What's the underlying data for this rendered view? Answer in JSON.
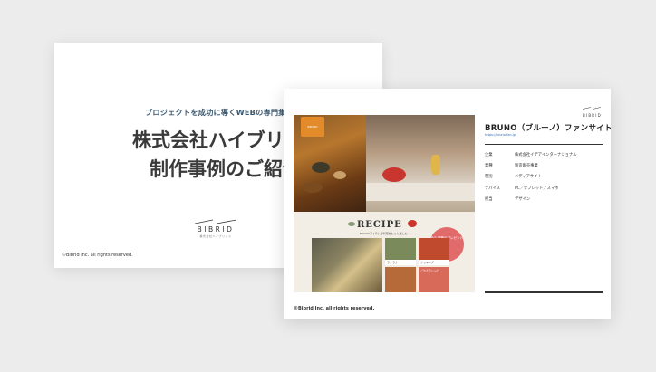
{
  "back_slide": {
    "tagline": "プロジェクトを成功に導くWEBの専門集団",
    "title_line1": "株式会社ハイブリッド",
    "title_line2": "制作事例のご紹介",
    "logo_word": "BIBRID",
    "logo_sub": "株式会社ハイブリッド",
    "copyright": "©Bibrid Inc. all rights reserved."
  },
  "front_slide": {
    "logo_word": "BIBRID",
    "case_title": "BRUNO（ブルーノ）ファンサイト",
    "case_url": "https://bruno-fan.jp",
    "info": [
      {
        "key": "企業",
        "value": "株式会社イデアインターナショナル"
      },
      {
        "key": "業種",
        "value": "製造販売事業"
      },
      {
        "key": "種別",
        "value": "メディアサイト"
      },
      {
        "key": "デバイス",
        "value": "PC／タブレット／スマホ"
      },
      {
        "key": "担当",
        "value": "デザイン"
      }
    ],
    "copyright": "©Bibrid Inc. all rights reserved.",
    "screenshot": {
      "hero_sign": "BRUNO",
      "recipe_title": "RECIPE",
      "recipe_sub": "BRUNOアイテムで料理をもっと楽しむ",
      "promo": "冬の 季節のプレゼント",
      "card_captions": [
        "ラクラク",
        "クッキング",
        "ごちそうレシピ"
      ]
    }
  },
  "colors": {
    "background": "#ececec",
    "tagline": "#3c5970",
    "url_link": "#2b6bb3",
    "promo": "#e16a6a"
  }
}
